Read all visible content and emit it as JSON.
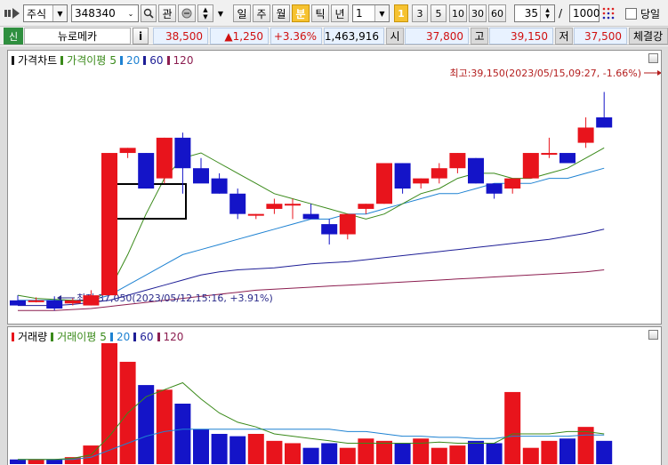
{
  "toolbar": {
    "market_type": "주식",
    "stock_code": "348340",
    "btn_search": "⌕",
    "btn_interest": "관",
    "periods": [
      "일",
      "주",
      "월",
      "분",
      "틱",
      "년"
    ],
    "active_period": "분",
    "interval_value": "1",
    "interval_buttons": [
      "1",
      "3",
      "5",
      "10",
      "30",
      "60"
    ],
    "active_interval": "1",
    "count_value": "35",
    "slash": "/",
    "count_max": "1000",
    "today_label": "당일"
  },
  "quote": {
    "badge": "신",
    "stock_name": "뉴로메카",
    "info_btn": "i",
    "price": "38,500",
    "change": "▲1,250",
    "change_pct": "+3.36%",
    "volume": "1,463,916",
    "open_label": "시",
    "open": "37,800",
    "high_label": "고",
    "high": "39,150",
    "low_label": "저",
    "low": "37,500",
    "exec_label": "체결강"
  },
  "price_panel": {
    "title": "가격차트",
    "ma_label": "가격이평",
    "ma_periods": [
      "5",
      "20",
      "60",
      "120"
    ],
    "high_annotation": "최고:39,150(2023/05/15,09:27, -1.66%)",
    "low_annotation": "최저:37,050(2023/05/12,15:16, +3.91%)"
  },
  "volume_panel": {
    "title": "거래량",
    "ma_label": "거래이평",
    "ma_periods": [
      "5",
      "20",
      "60",
      "120"
    ]
  },
  "colors": {
    "up": "#e8141c",
    "down": "#1414c8",
    "ma5": "#3a8a1a",
    "ma20": "#1e82d2",
    "ma60": "#1e1e96",
    "ma120": "#8c1e50",
    "annotation": "#b41e1e"
  },
  "chart_data": {
    "type": "candlestick",
    "candles": [
      {
        "o": 37100,
        "h": 37150,
        "l": 37080,
        "c": 37050
      },
      {
        "o": 37100,
        "h": 37130,
        "l": 37080,
        "c": 37100
      },
      {
        "o": 37100,
        "h": 37140,
        "l": 37000,
        "c": 37020
      },
      {
        "o": 37070,
        "h": 37120,
        "l": 37050,
        "c": 37100
      },
      {
        "o": 37050,
        "h": 37200,
        "l": 37050,
        "c": 37150
      },
      {
        "o": 37150,
        "h": 38550,
        "l": 37300,
        "c": 38550
      },
      {
        "o": 38550,
        "h": 38600,
        "l": 38500,
        "c": 38600
      },
      {
        "o": 38550,
        "h": 38550,
        "l": 38200,
        "c": 38200
      },
      {
        "o": 38300,
        "h": 38700,
        "l": 38250,
        "c": 38700
      },
      {
        "o": 38700,
        "h": 38750,
        "l": 38150,
        "c": 38400
      },
      {
        "o": 38400,
        "h": 38500,
        "l": 38300,
        "c": 38250
      },
      {
        "o": 38300,
        "h": 38350,
        "l": 38150,
        "c": 38150
      },
      {
        "o": 38150,
        "h": 38200,
        "l": 37900,
        "c": 37950
      },
      {
        "o": 37950,
        "h": 37950,
        "l": 37900,
        "c": 37950
      },
      {
        "o": 38000,
        "h": 38100,
        "l": 37950,
        "c": 38050
      },
      {
        "o": 38050,
        "h": 38100,
        "l": 37900,
        "c": 38050
      },
      {
        "o": 37950,
        "h": 38050,
        "l": 37900,
        "c": 37900
      },
      {
        "o": 37850,
        "h": 37900,
        "l": 37650,
        "c": 37750
      },
      {
        "o": 37750,
        "h": 37950,
        "l": 37700,
        "c": 37950
      },
      {
        "o": 38000,
        "h": 38050,
        "l": 37950,
        "c": 38050
      },
      {
        "o": 38050,
        "h": 38450,
        "l": 38050,
        "c": 38450
      },
      {
        "o": 38450,
        "h": 38450,
        "l": 38150,
        "c": 38200
      },
      {
        "o": 38250,
        "h": 38300,
        "l": 38200,
        "c": 38300
      },
      {
        "o": 38300,
        "h": 38450,
        "l": 38250,
        "c": 38400
      },
      {
        "o": 38400,
        "h": 38550,
        "l": 38350,
        "c": 38550
      },
      {
        "o": 38500,
        "h": 38500,
        "l": 38250,
        "c": 38250
      },
      {
        "o": 38250,
        "h": 38250,
        "l": 38100,
        "c": 38150
      },
      {
        "o": 38200,
        "h": 38300,
        "l": 38150,
        "c": 38300
      },
      {
        "o": 38300,
        "h": 38550,
        "l": 38300,
        "c": 38550
      },
      {
        "o": 38550,
        "h": 38700,
        "l": 38500,
        "c": 38550
      },
      {
        "o": 38550,
        "h": 38500,
        "l": 38500,
        "c": 38450
      },
      {
        "o": 38650,
        "h": 38900,
        "l": 38600,
        "c": 38800
      },
      {
        "o": 38900,
        "h": 39150,
        "l": 38800,
        "c": 38800
      }
    ],
    "ma5": [
      37150,
      37120,
      37110,
      37100,
      37090,
      37200,
      37550,
      37950,
      38300,
      38500,
      38550,
      38450,
      38350,
      38250,
      38150,
      38100,
      38050,
      38000,
      37950,
      37900,
      37950,
      38050,
      38150,
      38200,
      38300,
      38350,
      38350,
      38300,
      38300,
      38350,
      38400,
      38500,
      38600
    ],
    "ma20": [
      37100,
      37100,
      37100,
      37100,
      37100,
      37150,
      37250,
      37350,
      37450,
      37550,
      37600,
      37650,
      37700,
      37750,
      37800,
      37850,
      37900,
      37900,
      37950,
      37950,
      38000,
      38050,
      38100,
      38150,
      38150,
      38200,
      38250,
      38250,
      38250,
      38300,
      38300,
      38350,
      38400
    ],
    "ma60": [
      37050,
      37050,
      37050,
      37060,
      37080,
      37100,
      37150,
      37200,
      37250,
      37300,
      37350,
      37380,
      37400,
      37410,
      37420,
      37440,
      37460,
      37470,
      37480,
      37500,
      37520,
      37540,
      37560,
      37580,
      37600,
      37620,
      37640,
      37660,
      37680,
      37700,
      37730,
      37760,
      37800
    ],
    "ma120": [
      37000,
      37000,
      37000,
      37010,
      37020,
      37040,
      37060,
      37080,
      37100,
      37120,
      37140,
      37160,
      37180,
      37200,
      37210,
      37220,
      37230,
      37240,
      37250,
      37260,
      37270,
      37280,
      37290,
      37300,
      37310,
      37320,
      37330,
      37340,
      37350,
      37360,
      37370,
      37380,
      37400
    ],
    "volume": [
      2000,
      2000,
      2000,
      3000,
      8000,
      52000,
      44000,
      34000,
      32000,
      26000,
      15000,
      13000,
      12000,
      13000,
      10000,
      9000,
      7000,
      9000,
      7000,
      11000,
      10000,
      9000,
      11000,
      7000,
      8000,
      10000,
      9000,
      31000,
      7000,
      10000,
      11000,
      16000,
      10000
    ],
    "vma5": [
      2000,
      2000,
      2000,
      2500,
      4000,
      12000,
      22000,
      29000,
      32000,
      35000,
      28000,
      22000,
      18000,
      16000,
      13000,
      12000,
      11000,
      10000,
      9000,
      9000,
      9000,
      9000,
      9000,
      9500,
      9000,
      9000,
      9000,
      13000,
      13000,
      13000,
      14000,
      14000,
      13000
    ],
    "vma20": [
      2000,
      2000,
      2000,
      2000,
      3000,
      6000,
      9000,
      12000,
      14000,
      15000,
      15000,
      15000,
      15000,
      15000,
      15000,
      15000,
      15000,
      15000,
      14000,
      14000,
      13000,
      12000,
      12000,
      11500,
      11500,
      11000,
      11000,
      12000,
      12000,
      12000,
      12000,
      12500,
      12500
    ]
  }
}
